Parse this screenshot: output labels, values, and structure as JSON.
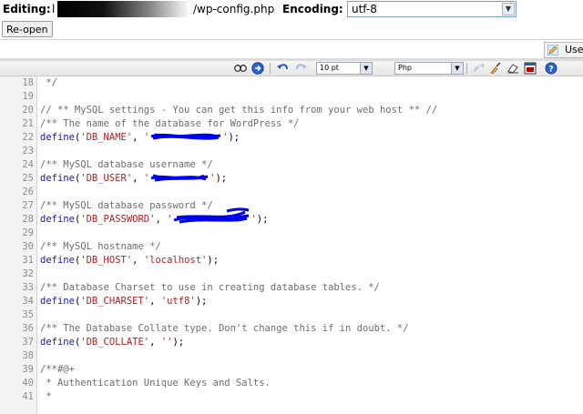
{
  "header": {
    "editing_label": "Editing:",
    "path_prefix": "l",
    "path_file": "/wp-config.php",
    "encoding_label": "Encoding:",
    "encoding_value": "utf-8"
  },
  "buttons": {
    "reopen": "Re-open",
    "use": "Use"
  },
  "toolbar": {
    "font_size": "10 pt",
    "syntax": "Php"
  },
  "code_lines": [
    {
      "n": "18",
      "html": "<span class=\"cmt\"> */</span>"
    },
    {
      "n": "19",
      "html": ""
    },
    {
      "n": "20",
      "html": "<span class=\"cmt\">// ** MySQL settings - You can get this info from your web host ** //</span>"
    },
    {
      "n": "21",
      "html": "<span class=\"cmt\">/** The name of the database for WordPress */</span>"
    },
    {
      "n": "22",
      "html": "<span class=\"kw\">define</span>(<span class=\"str\">'DB_NAME'</span>, <span class=\"str\">'</span>R1<span class=\"str\">'</span>);"
    },
    {
      "n": "23",
      "html": ""
    },
    {
      "n": "24",
      "html": "<span class=\"cmt\">/** MySQL database username */</span>"
    },
    {
      "n": "25",
      "html": "<span class=\"kw\">define</span>(<span class=\"str\">'DB_USER'</span>, <span class=\"str\">'</span>R2<span class=\"str\">'</span>);"
    },
    {
      "n": "26",
      "html": ""
    },
    {
      "n": "27",
      "html": "<span class=\"cmt\">/** MySQL database password */</span>"
    },
    {
      "n": "28",
      "html": "<span class=\"kw\">define</span>(<span class=\"str\">'DB_PASSWORD'</span>, <span class=\"str\">'</span>R3<span class=\"str\">'</span>);"
    },
    {
      "n": "29",
      "html": ""
    },
    {
      "n": "30",
      "html": "<span class=\"cmt\">/** MySQL hostname */</span>"
    },
    {
      "n": "31",
      "html": "<span class=\"kw\">define</span>(<span class=\"str\">'DB_HOST'</span>, <span class=\"str\">'localhost'</span>);"
    },
    {
      "n": "32",
      "html": ""
    },
    {
      "n": "33",
      "html": "<span class=\"cmt\">/** Database Charset to use in creating database tables. */</span>"
    },
    {
      "n": "34",
      "html": "<span class=\"kw\">define</span>(<span class=\"str\">'DB_CHARSET'</span>, <span class=\"str\">'utf8'</span>);"
    },
    {
      "n": "35",
      "html": ""
    },
    {
      "n": "36",
      "html": "<span class=\"cmt\">/** The Database Collate type. Don't change this if in doubt. */</span>"
    },
    {
      "n": "37",
      "html": "<span class=\"kw\">define</span>(<span class=\"str\">'DB_COLLATE'</span>, <span class=\"str\">''</span>);"
    },
    {
      "n": "38",
      "html": ""
    },
    {
      "n": "39",
      "html": "<span class=\"cmt\">/**#@+</span>"
    },
    {
      "n": "40",
      "html": "<span class=\"cmt\"> * Authentication Unique Keys and Salts.</span>"
    },
    {
      "n": "41",
      "html": "<span class=\"cmt\"> *</span>"
    }
  ]
}
